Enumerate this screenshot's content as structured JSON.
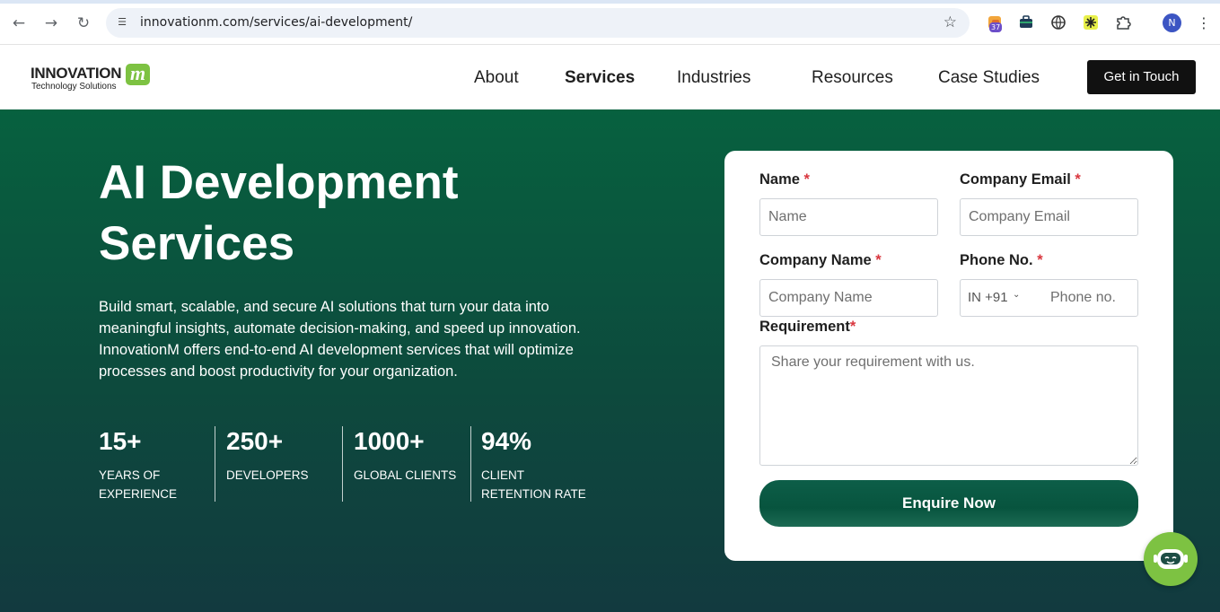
{
  "browser": {
    "url": "innovationm.com/services/ai-development/",
    "extension_badge": "37",
    "profile_initial": "N"
  },
  "header": {
    "logo_brand": "INNOVATION",
    "logo_mark": "m",
    "logo_tagline": "Technology Solutions",
    "nav": {
      "about": "About",
      "services": "Services",
      "industries": "Industries",
      "resources": "Resources",
      "case_studies": "Case Studies"
    },
    "cta_label": "Get in Touch"
  },
  "hero": {
    "title_line1": "AI Development",
    "title_line2": "Services",
    "description": "Build smart, scalable, and secure AI solutions that turn your data into meaningful insights, automate decision-making, and speed up innovation. InnovationM offers end-to-end AI development services that will optimize processes and boost productivity for your organization.",
    "stats": [
      {
        "value": "15+",
        "label_line1": "YEARS OF",
        "label_line2": "EXPERIENCE"
      },
      {
        "value": "250+",
        "label_line1": "DEVELOPERS",
        "label_line2": ""
      },
      {
        "value": "1000+",
        "label_line1": "GLOBAL CLIENTS",
        "label_line2": ""
      },
      {
        "value": "94%",
        "label_line1": "CLIENT",
        "label_line2": "RETENTION RATE"
      }
    ]
  },
  "form": {
    "name_label": "Name",
    "name_placeholder": "Name",
    "email_label": "Company Email",
    "email_placeholder": "Company Email",
    "company_label": "Company Name",
    "company_placeholder": "Company Name",
    "phone_label": "Phone No.",
    "phone_country": "IN +91",
    "phone_placeholder": "Phone no.",
    "requirement_label": "Requirement",
    "requirement_placeholder": "Share your requirement with us.",
    "required_mark": "*",
    "submit_label": "Enquire Now"
  },
  "colors": {
    "hero_top": "#07613f",
    "hero_bottom": "#123a3f",
    "accent_green": "#7dc242",
    "required_red": "#d9363e",
    "cta_dark": "#111111"
  }
}
